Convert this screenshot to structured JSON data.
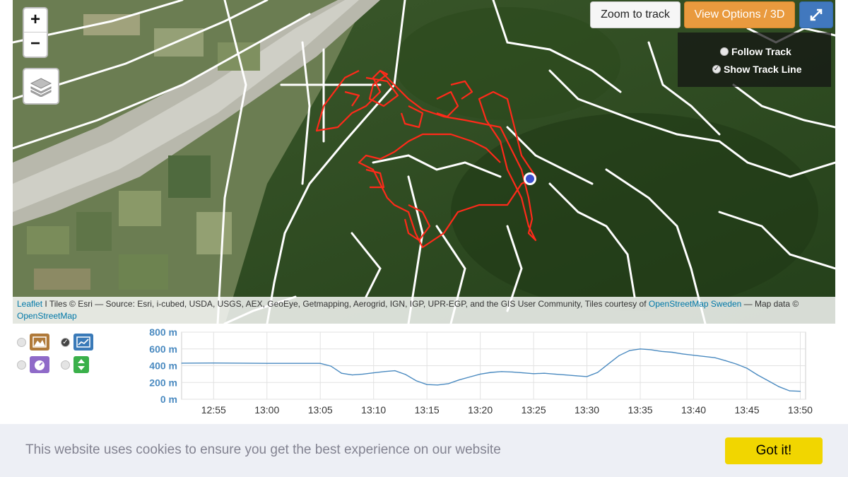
{
  "map": {
    "zoom_in_label": "+",
    "zoom_out_label": "−",
    "layers_icon": "layers-icon",
    "zoom_to_track_label": "Zoom to track",
    "view_options_label": "View Options / 3D",
    "fullscreen_icon": "expand-icon",
    "follow_track_label": "Follow Track",
    "show_track_line_label": "Show Track Line",
    "track_color": "#ff2a1a",
    "marker_color": "#3a4fd0",
    "attribution": {
      "leaflet": "Leaflet",
      "tiles_text": " I Tiles © Esri — Source: Esri, i-cubed, USDA, USGS, AEX, GeoEye, Getmapping, Aerogrid, IGN, IGP, UPR-EGP, and the GIS User Community, Tiles courtesy of ",
      "osm_sweden": "OpenStreetMap Sweden",
      "tail": " — Map data © ",
      "osm": "OpenStreetMap"
    }
  },
  "chart_controls": [
    {
      "icon": "terrain-icon",
      "color": "#b07a3a",
      "selected": false
    },
    {
      "icon": "line-chart-icon",
      "color": "#3a7ab8",
      "selected": true
    },
    {
      "icon": "speedometer-icon",
      "color": "#8f6ac8",
      "selected": false
    },
    {
      "icon": "up-down-arrows-icon",
      "color": "#3ab04a",
      "selected": false
    }
  ],
  "chart_data": {
    "type": "line",
    "ylabel_ticks": [
      "800 m",
      "600 m",
      "400 m",
      "200 m",
      "0 m"
    ],
    "ylim": [
      0,
      800
    ],
    "x_ticks": [
      "12:55",
      "13:00",
      "13:05",
      "13:10",
      "13:15",
      "13:20",
      "13:25",
      "13:30",
      "13:35",
      "13:40",
      "13:45",
      "13:50"
    ],
    "xlim_minutes": [
      52,
      110.5
    ],
    "grid": true,
    "color": "#4a8ac0",
    "series": [
      {
        "x": [
          "12:52",
          "12:55",
          "13:00",
          "13:05",
          "13:06",
          "13:07",
          "13:08",
          "13:09",
          "13:10",
          "13:11",
          "13:12",
          "13:13",
          "13:14",
          "13:15",
          "13:16",
          "13:17",
          "13:18",
          "13:19",
          "13:20",
          "13:21",
          "13:22",
          "13:23",
          "13:24",
          "13:25",
          "13:26",
          "13:27",
          "13:28",
          "13:29",
          "13:30",
          "13:31",
          "13:32",
          "13:33",
          "13:34",
          "13:35",
          "13:36",
          "13:37",
          "13:38",
          "13:39",
          "13:40",
          "13:41",
          "13:42",
          "13:43",
          "13:44",
          "13:45",
          "13:46",
          "13:47",
          "13:48",
          "13:49",
          "13:50"
        ],
        "y": [
          430,
          432,
          428,
          428,
          395,
          310,
          290,
          300,
          315,
          330,
          340,
          295,
          220,
          175,
          170,
          185,
          230,
          265,
          300,
          320,
          330,
          325,
          315,
          305,
          310,
          300,
          290,
          280,
          270,
          320,
          420,
          520,
          580,
          600,
          590,
          570,
          560,
          540,
          525,
          510,
          495,
          460,
          420,
          370,
          290,
          220,
          150,
          100,
          95
        ]
      }
    ]
  },
  "cookie": {
    "message": "This website uses cookies to ensure you get the best experience on our website",
    "button_label": "Got it!"
  }
}
